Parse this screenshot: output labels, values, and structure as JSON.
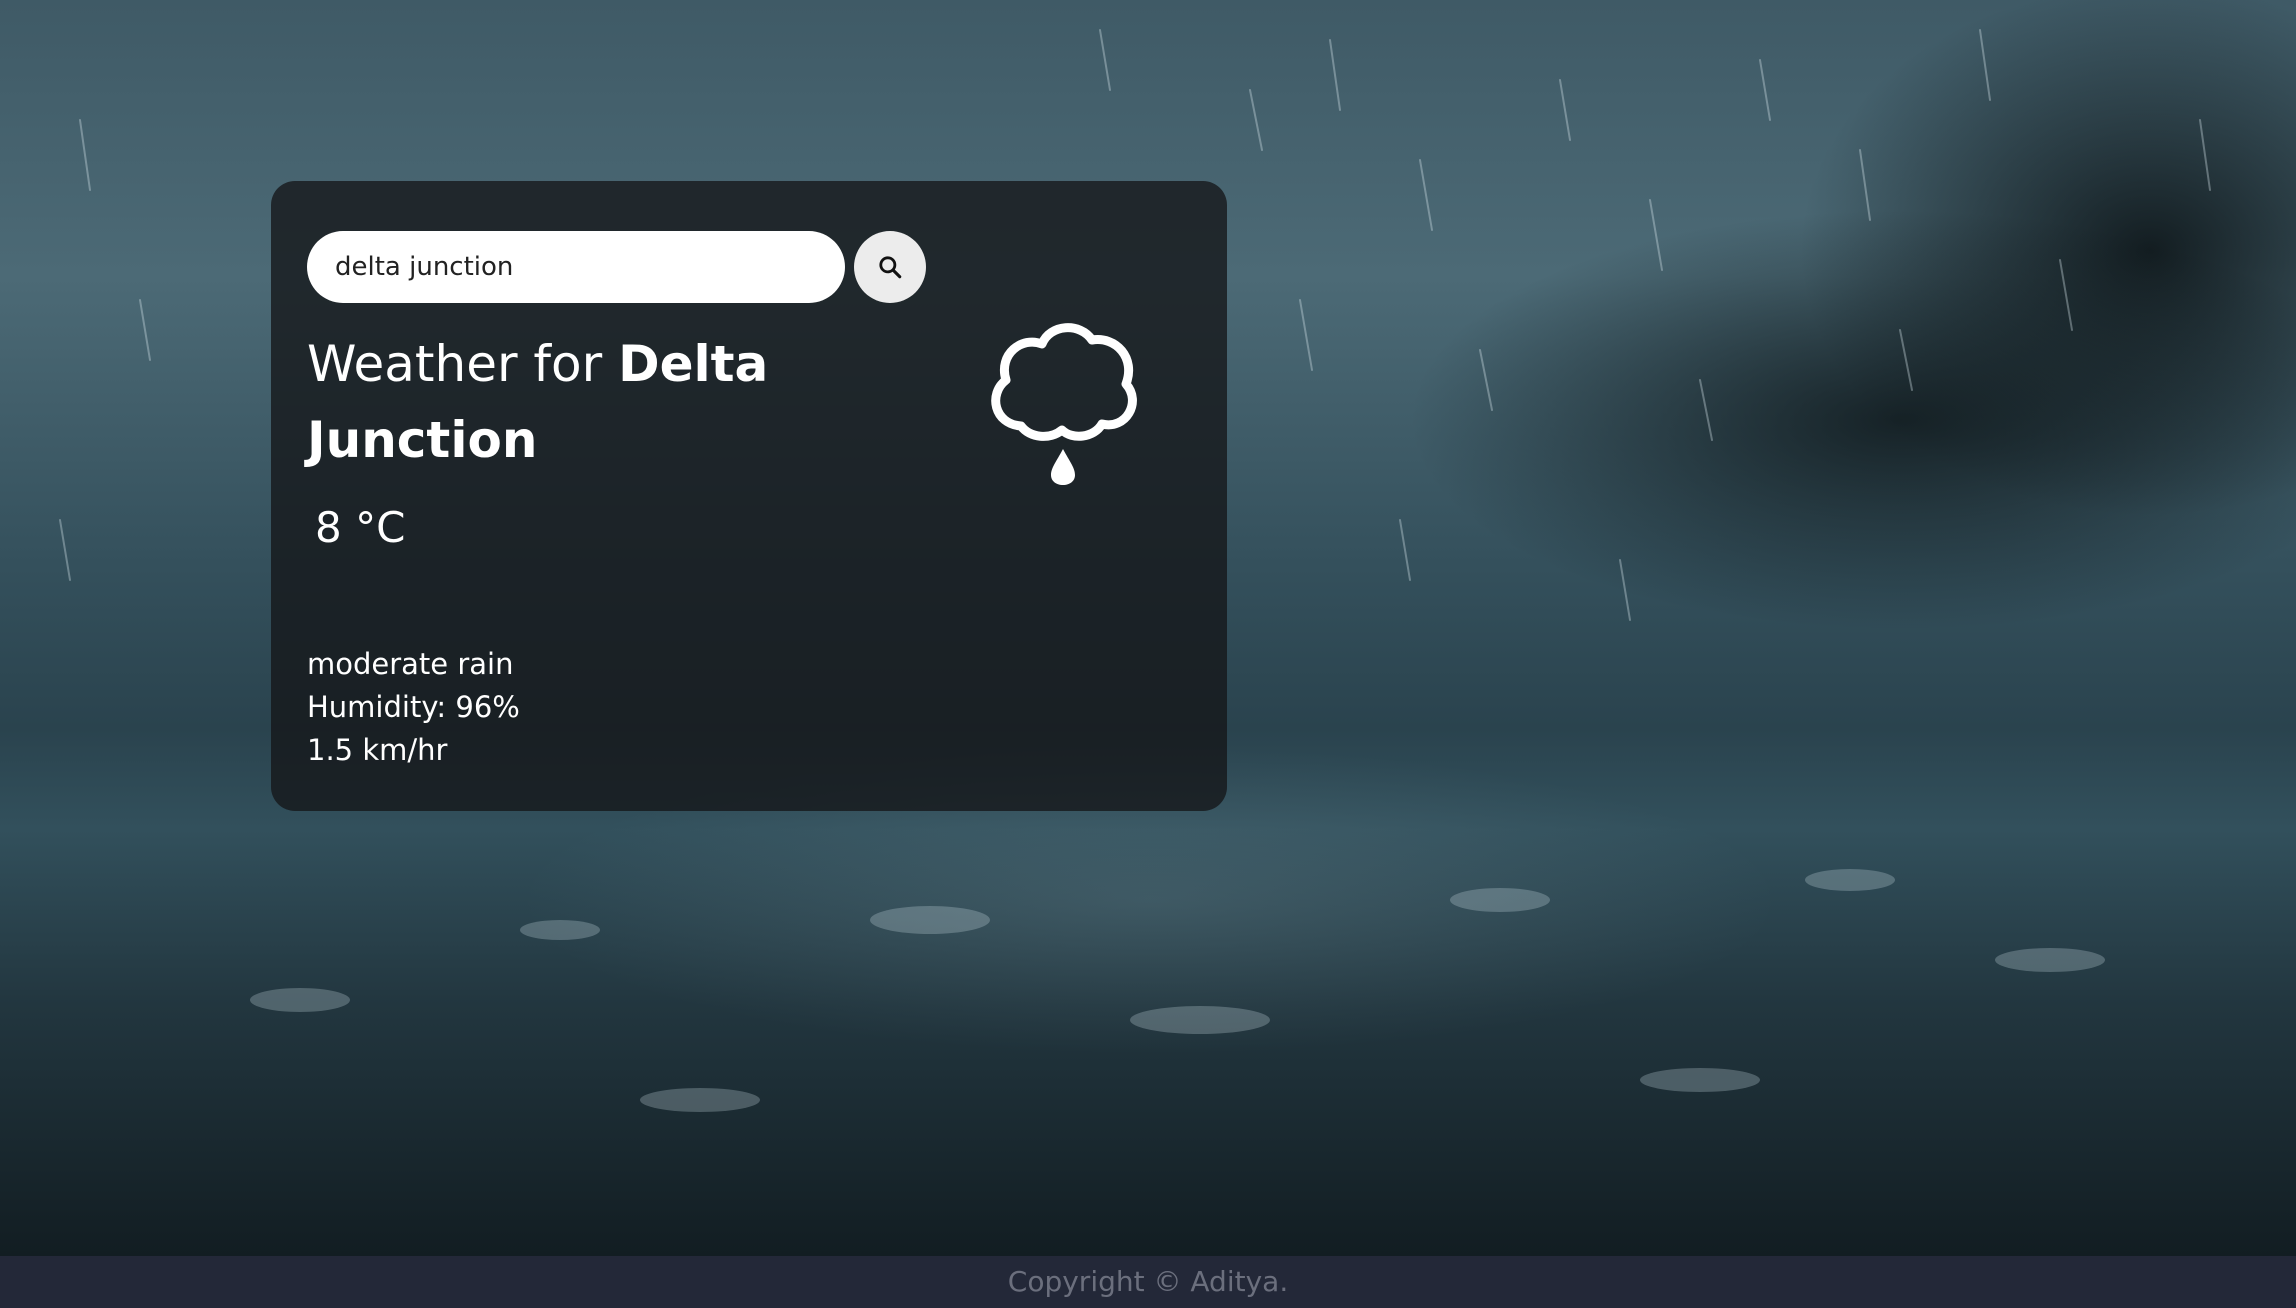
{
  "search": {
    "value": "delta junction",
    "button_icon": "search-icon"
  },
  "weather": {
    "title_prefix": "Weather for",
    "city": "Delta Junction",
    "temperature": "8 °C",
    "description": "moderate rain",
    "humidity": "Humidity: 96%",
    "wind": "1.5 km/hr",
    "icon": "rain-cloud-icon"
  },
  "footer": {
    "text": "Copyright © Aditya."
  },
  "colors": {
    "card_bg": "#141618",
    "footer_bg": "#232838",
    "footer_text": "#6b6f7d"
  }
}
